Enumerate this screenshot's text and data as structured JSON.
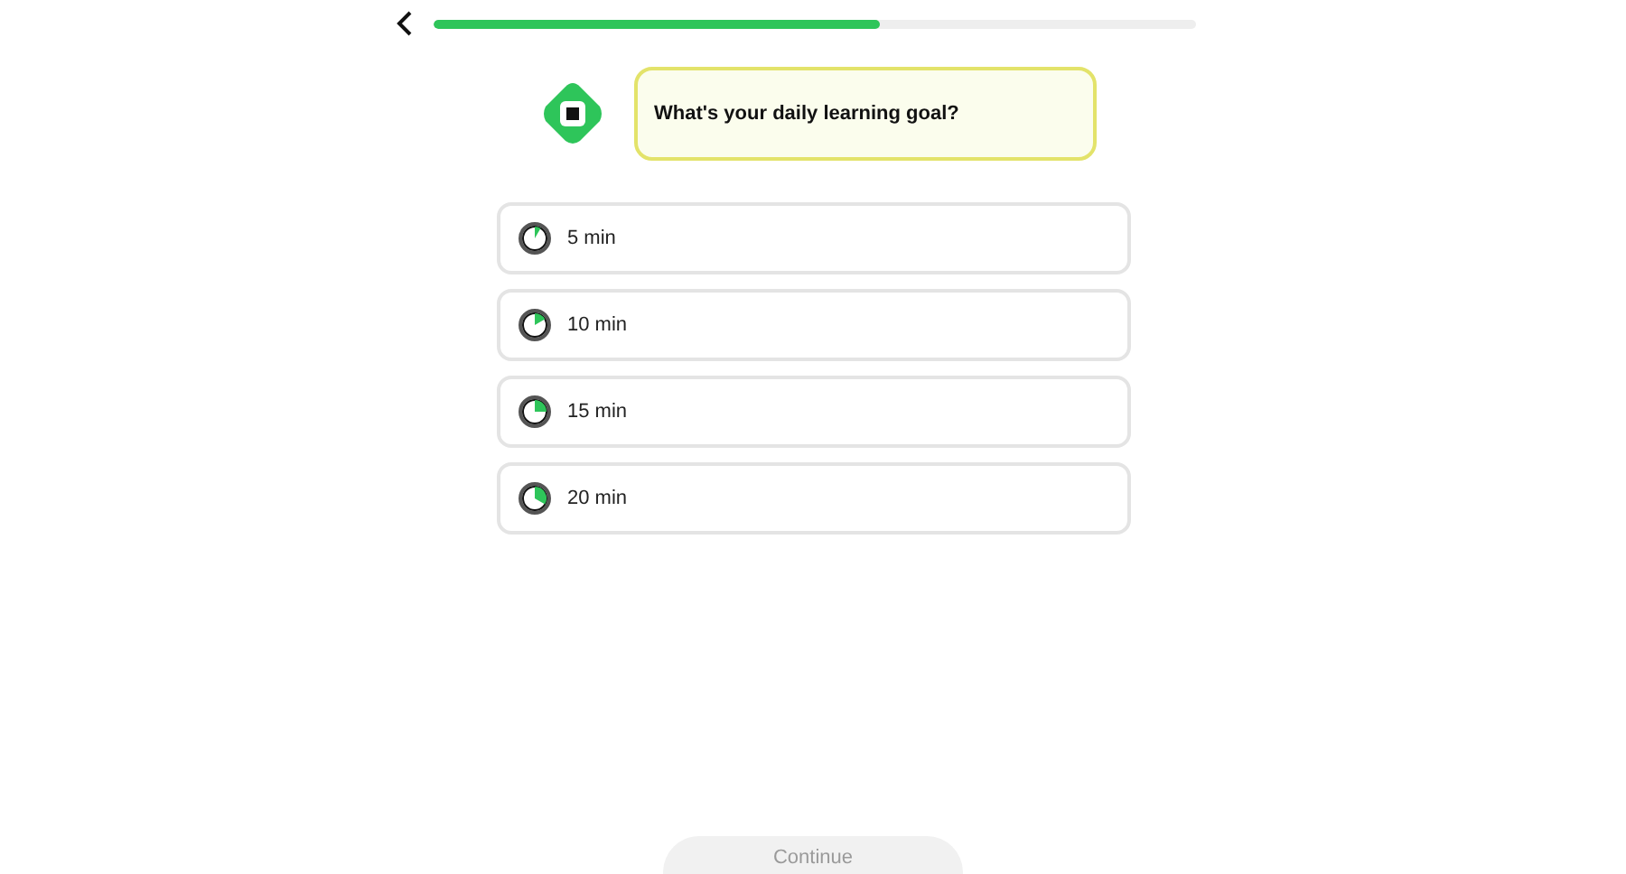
{
  "progress": {
    "level": 0.585
  },
  "prompt": "What's your daily learning goal?",
  "options": [
    {
      "label": "5 min",
      "selected": false
    },
    {
      "label": "10 min",
      "selected": false
    },
    {
      "label": "15 min",
      "selected": false
    },
    {
      "label": "20 min",
      "selected": false
    }
  ],
  "continue_button": {
    "label": "Continue",
    "disabled": true
  }
}
